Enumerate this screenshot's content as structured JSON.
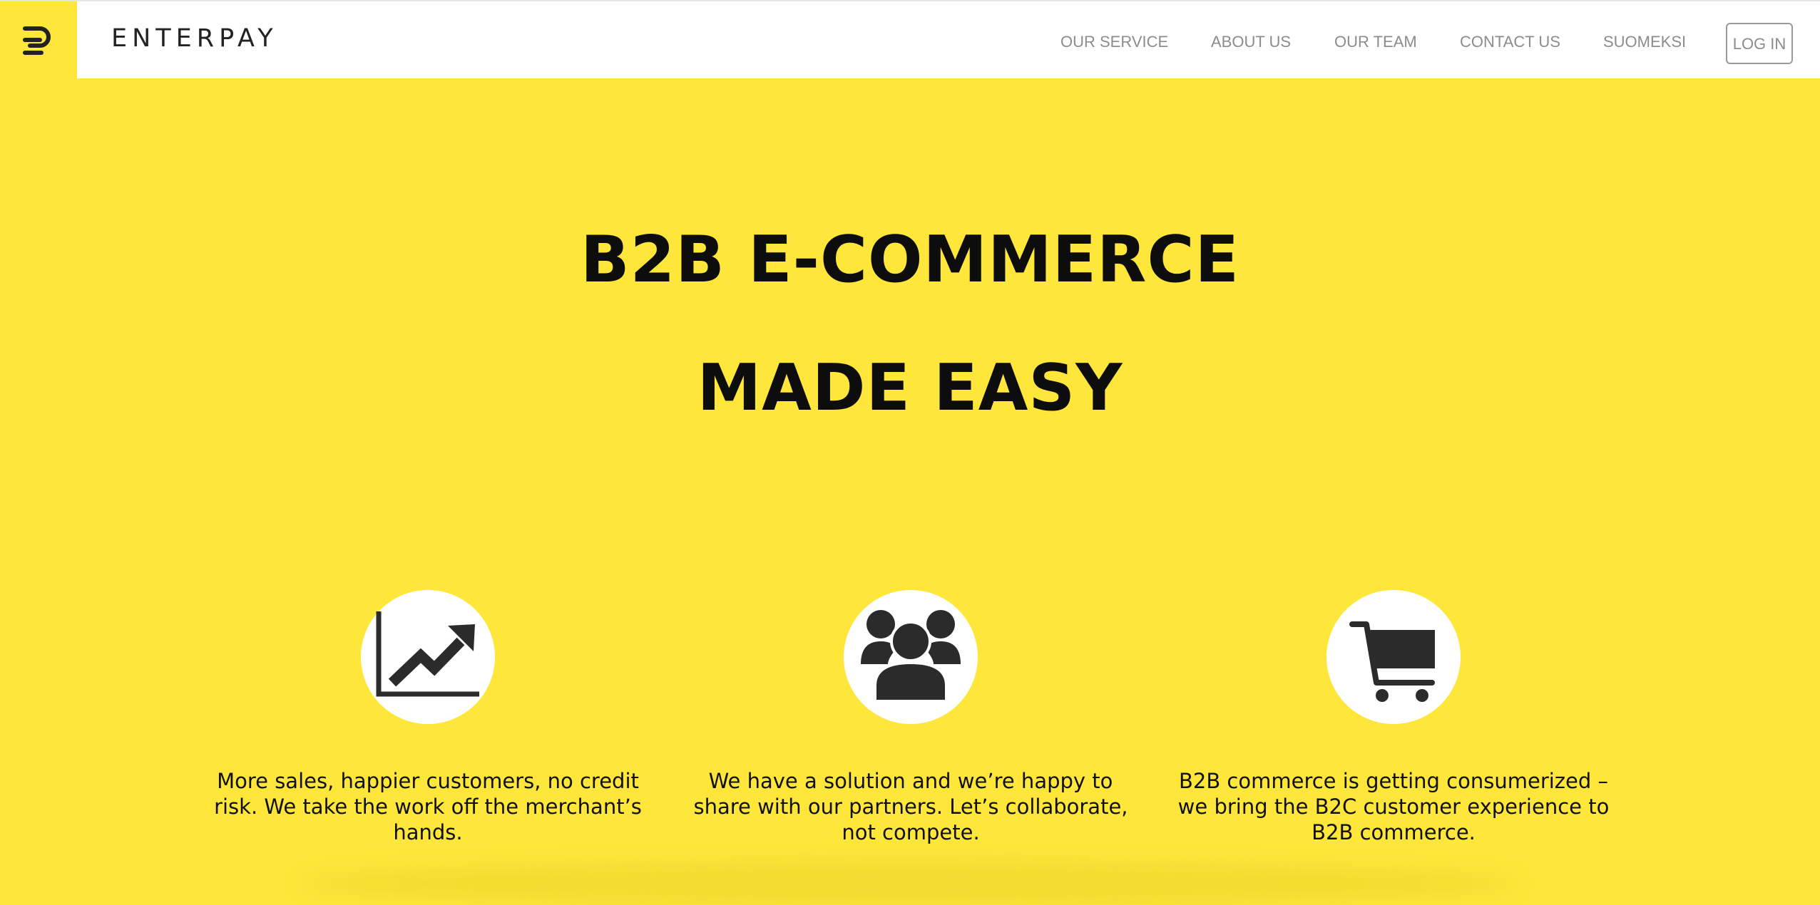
{
  "header": {
    "brand": "ENTERPAY",
    "logo_icon": "enterpay-e-logo-icon",
    "nav": [
      {
        "label": "OUR SERVICE"
      },
      {
        "label": "ABOUT US"
      },
      {
        "label": "OUR TEAM"
      },
      {
        "label": "CONTACT US"
      },
      {
        "label": "SUOMEKSI"
      }
    ],
    "login_label": "LOG IN"
  },
  "hero": {
    "line1": "B2B E-COMMERCE",
    "line2": "MADE EASY"
  },
  "features": [
    {
      "icon": "growth-chart-icon",
      "text": "More sales, happier customers, no credit risk. We take the work off  the merchant’s hands."
    },
    {
      "icon": "team-people-icon",
      "text": "We have a solution and we’re happy to share with our partners. Let’s collaborate, not compete."
    },
    {
      "icon": "shopping-cart-icon",
      "text": "B2B commerce is getting consumerized – we bring the B2C customer experience to B2B commerce."
    }
  ],
  "colors": {
    "background": "#FEE63A",
    "header": "#FFFFFF",
    "text": "#0D0D0D",
    "icon": "#2B2B2B",
    "nav_text": "#8C8C8C"
  }
}
